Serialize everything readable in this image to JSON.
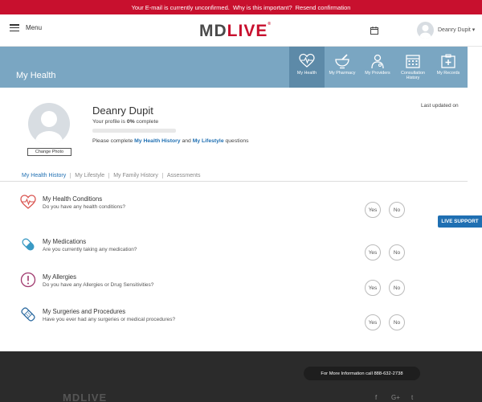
{
  "banner": {
    "message": "Your E-mail is currently unconfirmed.",
    "why_link": "Why is this important?",
    "resend_link": "Resend confirmation"
  },
  "topbar": {
    "menu_label": "Menu",
    "logo_md": "MD",
    "logo_live": "LIVE",
    "logo_mark": "®",
    "user_name": "Deanry Dupit ▾"
  },
  "health_header": {
    "title": "My Health",
    "nav": [
      {
        "label": "My Health",
        "icon": "heart-pulse-icon",
        "active": true
      },
      {
        "label": "My Pharmacy",
        "icon": "mortar-pestle-icon",
        "active": false
      },
      {
        "label": "My Providers",
        "icon": "stethoscope-icon",
        "active": false
      },
      {
        "label": "Consultation History",
        "icon": "calendar-grid-icon",
        "active": false
      },
      {
        "label": "My Records",
        "icon": "records-icon",
        "active": false
      }
    ]
  },
  "profile": {
    "name": "Deanry Dupit",
    "status_prefix": "Your profile is ",
    "status_value": "0%",
    "status_suffix": " complete",
    "progress_fraction": 0,
    "change_photo": "Change Photo",
    "complete_prefix": "Please complete ",
    "complete_link1": "My Health History",
    "complete_and": " and ",
    "complete_link2": "My Lifestyle",
    "complete_suffix": " questions",
    "last_updated": "Last updated on"
  },
  "tabs": [
    "My Health History",
    "My Lifestyle",
    "My Family History",
    "Assessments"
  ],
  "questions": [
    {
      "title": "My Health Conditions",
      "desc": "Do you have any health conditions?",
      "icon": "heart-pulse-icon"
    },
    {
      "title": "My Medications",
      "desc": "Are you currently taking any medication?",
      "icon": "pill-icon"
    },
    {
      "title": "My Allergies",
      "desc": "Do you have any Allergies or Drug Sensitivities?",
      "icon": "alert-icon"
    },
    {
      "title": "My Surgeries and Procedures",
      "desc": "Have you ever had any surgeries or medical procedures?",
      "icon": "bandage-icon"
    }
  ],
  "answers": {
    "yes": "Yes",
    "no": "No"
  },
  "live_support": "LIVE SUPPORT",
  "footer": {
    "info": "For More Information call 888-632-2738",
    "logo": "MDLIVE",
    "social": [
      "f",
      "G+",
      "t"
    ]
  },
  "colors": {
    "banner_red": "#c8102e",
    "header_blue": "#7aa6c2",
    "link_blue": "#1f6fb2",
    "icon_red": "#d9534f",
    "icon_teal": "#3a9ac4",
    "icon_purple": "#a0396e",
    "icon_navy": "#2c6aa0"
  }
}
